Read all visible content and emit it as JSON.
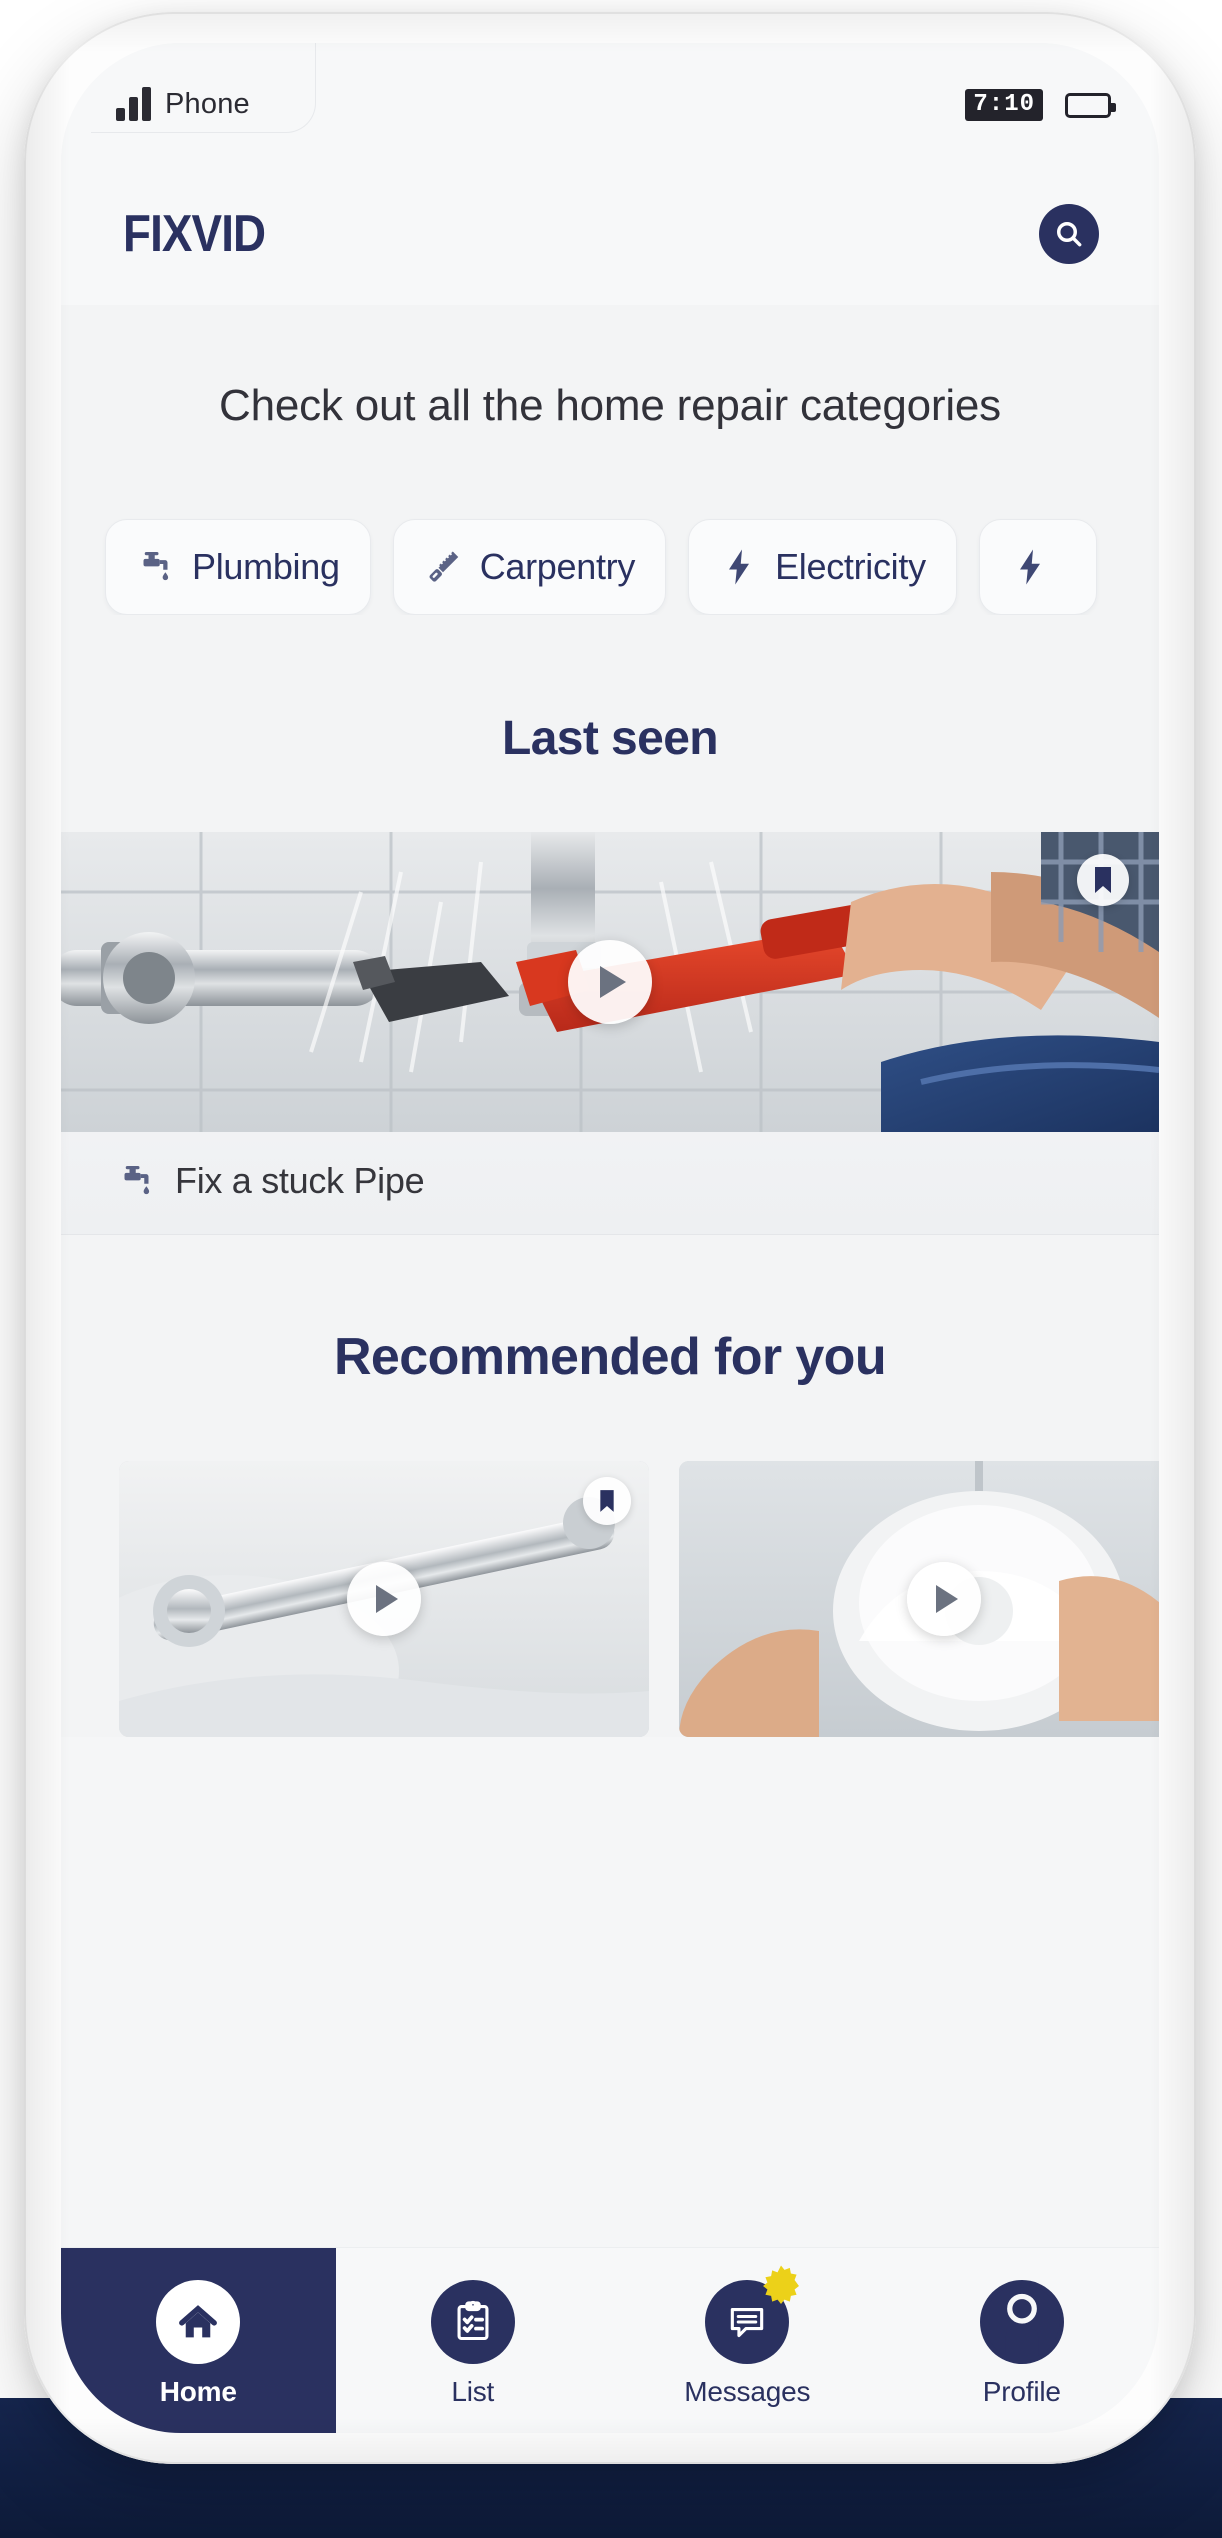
{
  "device": {
    "statusbar": {
      "carrier": "Phone",
      "signal_icon": "signal-bars-icon",
      "clock": "7:10",
      "battery_icon": "battery-icon"
    }
  },
  "header": {
    "logo": "FIXVID",
    "search_icon": "search-icon"
  },
  "hero": {
    "headline": "Check out all the home repair categories"
  },
  "categories": {
    "items": [
      {
        "label": "Plumbing",
        "icon": "faucet-icon"
      },
      {
        "label": "Carpentry",
        "icon": "saw-icon"
      },
      {
        "label": "Electricity",
        "icon": "lightning-bolt-icon"
      },
      {
        "label": "",
        "icon": "lightning-bolt-icon"
      }
    ]
  },
  "last_seen": {
    "title": "Last seen",
    "video": {
      "caption": "Fix a stuck Pipe",
      "caption_icon": "faucet-icon",
      "play_icon": "play-icon",
      "bookmark_icon": "bookmark-icon"
    }
  },
  "recommended": {
    "title": "Recommended for you",
    "cards": [
      {
        "play_icon": "play-icon",
        "bookmark_icon": "bookmark-icon"
      },
      {
        "play_icon": "play-icon",
        "bookmark_icon": "bookmark-icon"
      }
    ]
  },
  "bottom_nav": {
    "items": [
      {
        "label": "Home",
        "icon": "home-icon",
        "active": true,
        "badge": false
      },
      {
        "label": "List",
        "icon": "clipboard-icon",
        "active": false,
        "badge": false
      },
      {
        "label": "Messages",
        "icon": "chat-icon",
        "active": false,
        "badge": true
      },
      {
        "label": "Profile",
        "icon": "person-icon",
        "active": false,
        "badge": false
      }
    ]
  },
  "colors": {
    "navy": "#2a3160",
    "badge_yellow": "#ecd119",
    "screen_bg": "#f3f4f5",
    "chip_bg": "#fafbfc"
  }
}
